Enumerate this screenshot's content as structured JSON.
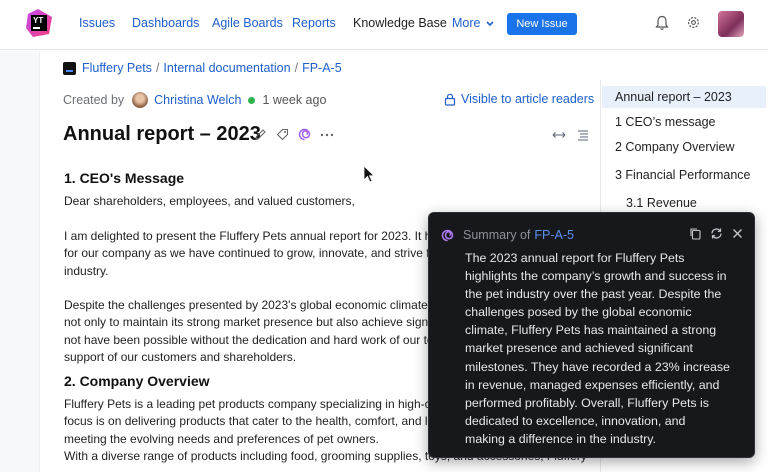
{
  "nav": {
    "logo_text": "YT",
    "links": [
      "Issues",
      "Dashboards",
      "Agile Boards",
      "Reports",
      "Knowledge Base",
      "More"
    ],
    "new_issue": "New Issue"
  },
  "breadcrumb": {
    "project": "Fluffery Pets",
    "folder": "Internal documentation",
    "article_id": "FP-A-5",
    "separator": "/"
  },
  "meta": {
    "created_by_label": "Created by",
    "author": "Christina Welch",
    "time": "1 week ago",
    "visibility": "Visible to article readers"
  },
  "article": {
    "title": "Annual report – 2023",
    "sections": [
      {
        "heading": "1. CEO's Message",
        "paragraphs": [
          [
            "Dear shareholders, employees, and valued customers,"
          ],
          [
            "I am delighted to present the Fluffery Pets annual report for 2023. It h",
            "for our company as we have continued to grow, innovate, and strive fo",
            "industry."
          ],
          [
            "Despite the challenges presented by 2023's global economic climate,",
            "not only to maintain its strong market presence but also achieve signi",
            "not have been possible without the dedication and hard work of our te",
            "support of our customers and shareholders."
          ]
        ]
      },
      {
        "heading": "2. Company Overview",
        "paragraphs": [
          [
            "Fluffery Pets is a leading pet products company specializing in high-c",
            "focus is on delivering products that cater to the health, comfort, and l",
            "meeting the evolving needs and preferences of pet owners.",
            "With a diverse range of products including food, grooming supplies, toys, and accessories, Fluffery"
          ]
        ]
      }
    ]
  },
  "toc": {
    "items": [
      "Annual report – 2023",
      "1 CEO’s message",
      "2 Company Overview",
      "3 Financial Performance",
      "3.1 Revenue"
    ]
  },
  "summary": {
    "label": "Summary of",
    "article_id": "FP-A-5",
    "lines": [
      "The 2023 annual report for Fluffery Pets",
      "highlights the company’s growth and success in",
      "the pet industry over the past year. Despite the",
      "challenges posed by the global economic",
      "climate, Fluffery Pets has maintained a strong",
      "market presence and achieved significant",
      "milestones. They have recorded a 23% increase",
      "in revenue, managed expenses efficiently, and",
      "performed profitably. Overall, Fluffery Pets is",
      "dedicated to excellence, innovation, and",
      "making a difference in the industry."
    ]
  },
  "colors": {
    "link": "#1d5fcc",
    "primary_button": "#1a73e8",
    "online": "#2fb34a",
    "popup_bg": "#17181b",
    "ai_icon": "#a05cf0"
  }
}
